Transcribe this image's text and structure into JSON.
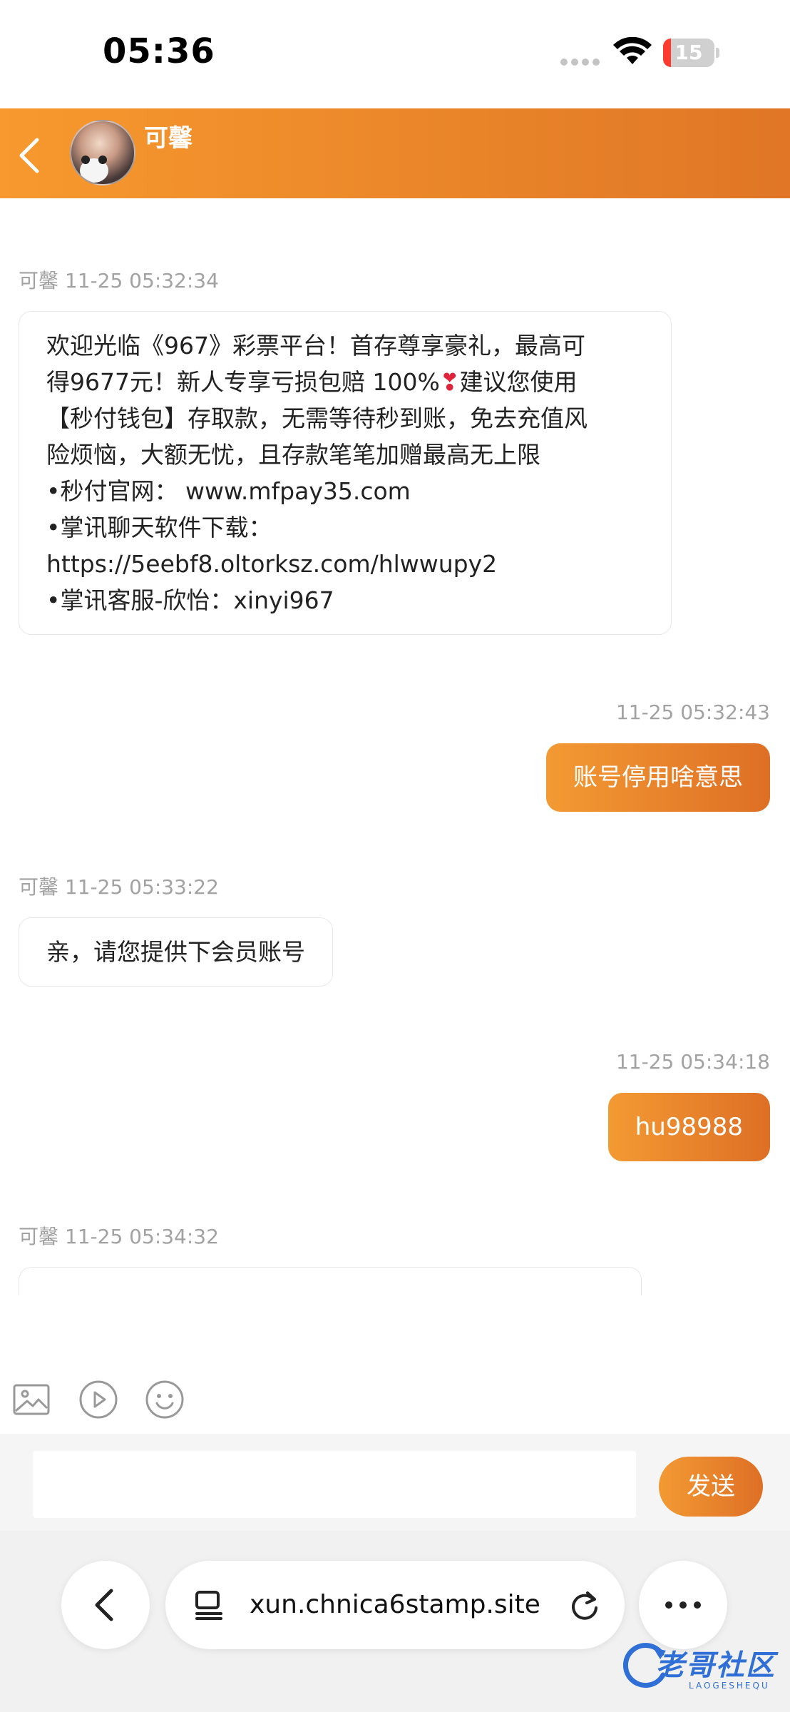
{
  "status_bar": {
    "time": "05:36",
    "battery": "15",
    "battery_level_percent": 15
  },
  "header": {
    "contact_name": "可馨"
  },
  "messages": [
    {
      "side": "in",
      "sender": "可馨",
      "time": "11-25 05:32:34",
      "lines": [
        "欢迎光临《967》彩票平台！首存尊享豪礼，最高可",
        "得9677元！新人专享亏损包赔 100%",
        "建议您使用",
        "【秒付钱包】存取款，无需等待秒到账，免去充值风",
        "险烦恼，大额无忧，且存款笔笔加赠最高无上限",
        "•秒付官网： www.mfpay35.com",
        "•掌讯聊天软件下载：",
        "https://5eebf8.oltorksz.com/hlwwupy2",
        "•掌讯客服-欣怡：xinyi967"
      ]
    },
    {
      "side": "out",
      "time": "11-25 05:32:43",
      "text": "账号停用啥意思"
    },
    {
      "side": "in",
      "sender": "可馨",
      "time": "11-25 05:33:22",
      "text": "亲，请您提供下会员账号"
    },
    {
      "side": "out",
      "time": "11-25 05:34:18",
      "text": "hu98988"
    },
    {
      "side": "in",
      "sender": "可馨",
      "time": "11-25 05:34:32"
    }
  ],
  "toolbar": {
    "icons": [
      "image-icon",
      "video-icon",
      "emoji-icon"
    ]
  },
  "composer": {
    "placeholder": "",
    "send_label": "发送"
  },
  "browser": {
    "url": "xun.chnica6stamp.site"
  },
  "watermark": {
    "text": "老哥社区",
    "sub": "LAOGESHEQU"
  },
  "colors": {
    "accent_start": "#f7992e",
    "accent_end": "#e07626",
    "battery_low": "#ff3b30"
  }
}
